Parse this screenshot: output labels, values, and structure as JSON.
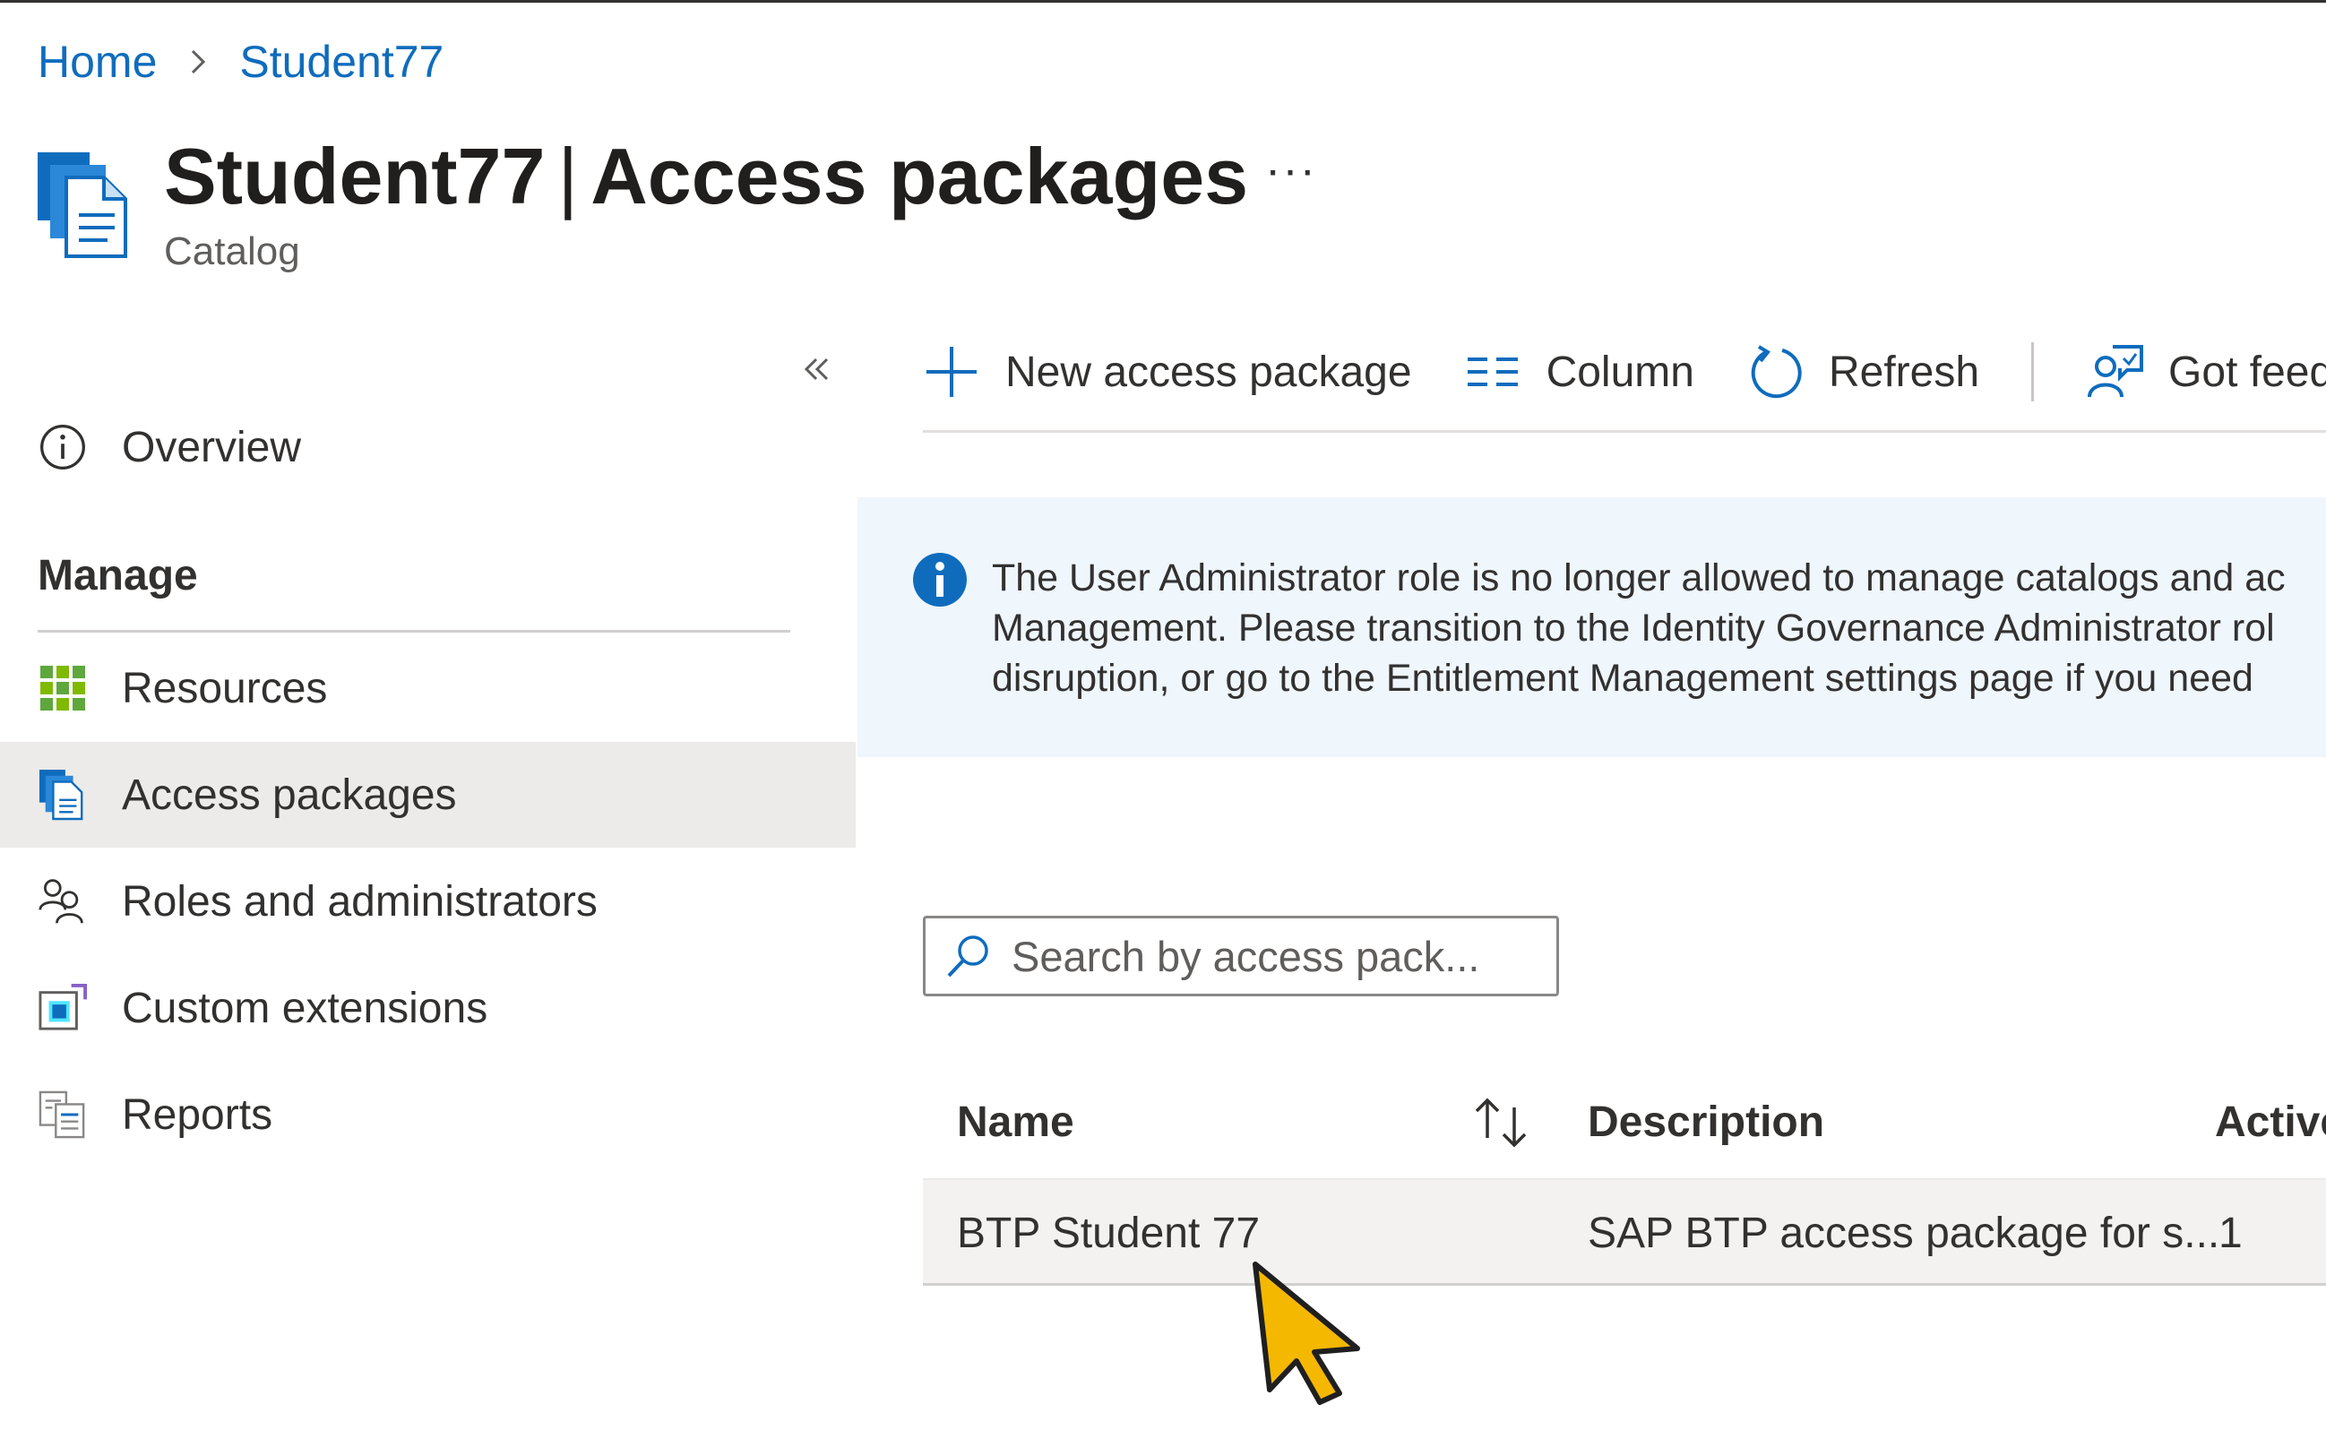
{
  "breadcrumb": {
    "home": "Home",
    "current": "Student77"
  },
  "header": {
    "title_bold": "Student77",
    "title_separator": "|",
    "title_rest": "Access packages",
    "more": "···",
    "subtitle": "Catalog"
  },
  "sidebar": {
    "overview": "Overview",
    "section": "Manage",
    "items": [
      {
        "label": "Resources",
        "icon": "grid-icon"
      },
      {
        "label": "Access packages",
        "icon": "access-package-icon",
        "active": true
      },
      {
        "label": "Roles and administrators",
        "icon": "people-icon"
      },
      {
        "label": "Custom extensions",
        "icon": "custom-extension-icon"
      },
      {
        "label": "Reports",
        "icon": "report-icon"
      }
    ]
  },
  "toolbar": {
    "new_package": "New access package",
    "column": "Column",
    "refresh": "Refresh",
    "feedback": "Got feed"
  },
  "banner": {
    "line1": "The User Administrator role is no longer allowed to manage catalogs and ac",
    "line2": "Management. Please transition to the Identity Governance Administrator rol",
    "line3": "disruption, or go to the Entitlement Management settings page if you need"
  },
  "search": {
    "placeholder": "Search by access pack..."
  },
  "table": {
    "columns": {
      "name": "Name",
      "description": "Description",
      "active": "Active"
    },
    "rows": [
      {
        "name": "BTP Student 77",
        "description": "SAP BTP access package for s...",
        "active": "1"
      }
    ]
  },
  "colors": {
    "accent": "#0f6cbd",
    "selected_bg": "#edebe9",
    "banner_bg": "#eff6fc",
    "cursor": "#f5b800"
  }
}
